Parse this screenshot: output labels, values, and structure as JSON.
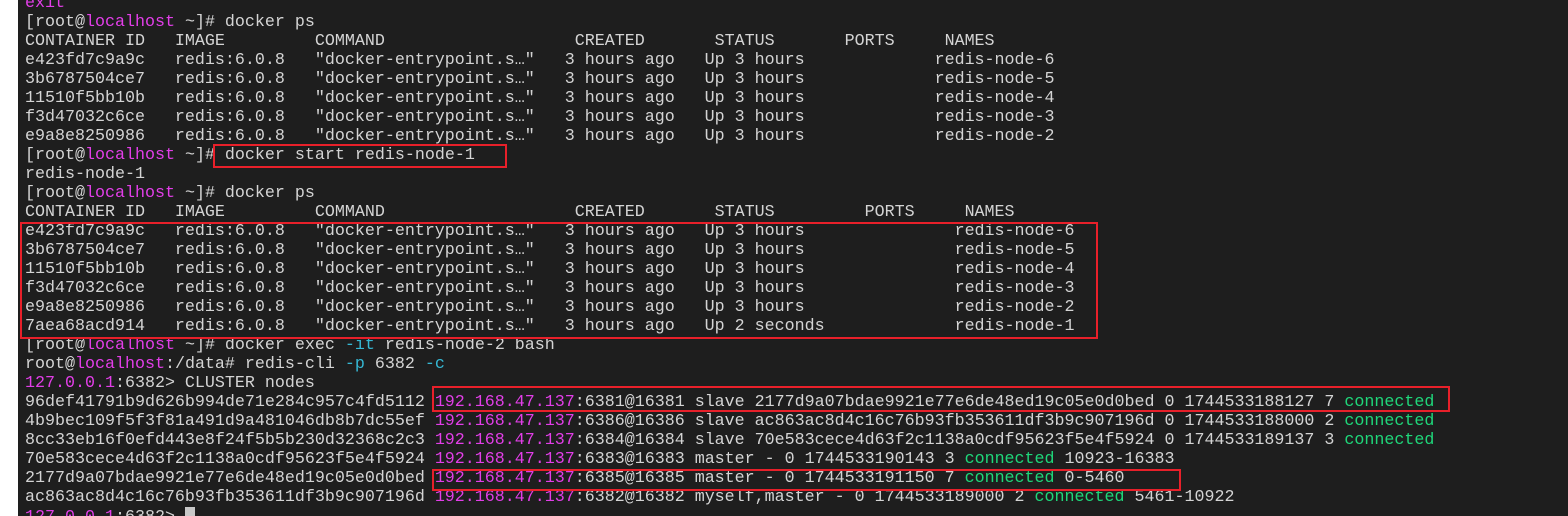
{
  "terminal": {
    "colors": {
      "background": "#1e1e1e",
      "text": "#d4d4d4",
      "host": "#e23ee8",
      "flag": "#35b8d4",
      "connected": "#1fd77a",
      "highlight_box": "#e8202a"
    },
    "lines": [
      [
        [
          "exit",
          "m"
        ]
      ],
      [
        [
          "[root@",
          ""
        ],
        [
          "localhost",
          "m"
        ],
        [
          " ~]# docker ps",
          ""
        ]
      ],
      [
        [
          "CONTAINER ID   IMAGE         COMMAND                   CREATED       STATUS       PORTS     NAMES",
          ""
        ]
      ],
      [
        [
          "e423fd7c9a9c   redis:6.0.8   \"docker-entrypoint.s…\"   3 hours ago   Up 3 hours             redis-node-6",
          ""
        ]
      ],
      [
        [
          "3b6787504ce7   redis:6.0.8   \"docker-entrypoint.s…\"   3 hours ago   Up 3 hours             redis-node-5",
          ""
        ]
      ],
      [
        [
          "11510f5bb10b   redis:6.0.8   \"docker-entrypoint.s…\"   3 hours ago   Up 3 hours             redis-node-4",
          ""
        ]
      ],
      [
        [
          "f3d47032c6ce   redis:6.0.8   \"docker-entrypoint.s…\"   3 hours ago   Up 3 hours             redis-node-3",
          ""
        ]
      ],
      [
        [
          "e9a8e8250986   redis:6.0.8   \"docker-entrypoint.s…\"   3 hours ago   Up 3 hours             redis-node-2",
          ""
        ]
      ],
      [
        [
          "[root@",
          ""
        ],
        [
          "localhost",
          "m"
        ],
        [
          " ~]# docker start redis-node-1",
          ""
        ]
      ],
      [
        [
          "redis-node-1",
          ""
        ]
      ],
      [
        [
          "[root@",
          ""
        ],
        [
          "localhost",
          "m"
        ],
        [
          " ~]# docker ps",
          ""
        ]
      ],
      [
        [
          "CONTAINER ID   IMAGE         COMMAND                   CREATED       STATUS         PORTS     NAMES",
          ""
        ]
      ],
      [
        [
          "e423fd7c9a9c   redis:6.0.8   \"docker-entrypoint.s…\"   3 hours ago   Up 3 hours               redis-node-6",
          ""
        ]
      ],
      [
        [
          "3b6787504ce7   redis:6.0.8   \"docker-entrypoint.s…\"   3 hours ago   Up 3 hours               redis-node-5",
          ""
        ]
      ],
      [
        [
          "11510f5bb10b   redis:6.0.8   \"docker-entrypoint.s…\"   3 hours ago   Up 3 hours               redis-node-4",
          ""
        ]
      ],
      [
        [
          "f3d47032c6ce   redis:6.0.8   \"docker-entrypoint.s…\"   3 hours ago   Up 3 hours               redis-node-3",
          ""
        ]
      ],
      [
        [
          "e9a8e8250986   redis:6.0.8   \"docker-entrypoint.s…\"   3 hours ago   Up 3 hours               redis-node-2",
          ""
        ]
      ],
      [
        [
          "7aea68acd914   redis:6.0.8   \"docker-entrypoint.s…\"   3 hours ago   Up 2 seconds             redis-node-1",
          ""
        ]
      ],
      [
        [
          "[root@",
          ""
        ],
        [
          "localhost",
          "m"
        ],
        [
          " ~]# docker exec ",
          ""
        ],
        [
          "-it",
          "c"
        ],
        [
          " redis-node-2 bash",
          ""
        ]
      ],
      [
        [
          "root@",
          ""
        ],
        [
          "localhost",
          "m"
        ],
        [
          ":/data# redis-cli ",
          ""
        ],
        [
          "-p",
          "c"
        ],
        [
          " 6382 ",
          ""
        ],
        [
          "-c",
          "c"
        ]
      ],
      [
        [
          "127.0.0.1",
          "m"
        ],
        [
          ":6382> CLUSTER nodes",
          ""
        ]
      ],
      [
        [
          "96def41791b9d626b994de71e284c957c4fd5112 ",
          ""
        ],
        [
          "192.168.47.137",
          "m"
        ],
        [
          ":6381@16381 slave 2177d9a07bdae9921e77e6de48ed19c05e0d0bed 0 1744533188127 7 ",
          ""
        ],
        [
          "connected",
          "g"
        ]
      ],
      [
        [
          "4b9bec109f5f3f81a491d9a481046db8b7dc55ef ",
          ""
        ],
        [
          "192.168.47.137",
          "m"
        ],
        [
          ":6386@16386 slave ac863ac8d4c16c76b93fb353611df3b9c907196d 0 1744533188000 2 ",
          ""
        ],
        [
          "connected",
          "g"
        ]
      ],
      [
        [
          "8cc33eb16f0efd443e8f24f5b5b230d32368c2c3 ",
          ""
        ],
        [
          "192.168.47.137",
          "m"
        ],
        [
          ":6384@16384 slave 70e583cece4d63f2c1138a0cdf95623f5e4f5924 0 1744533189137 3 ",
          ""
        ],
        [
          "connected",
          "g"
        ]
      ],
      [
        [
          "70e583cece4d63f2c1138a0cdf95623f5e4f5924 ",
          ""
        ],
        [
          "192.168.47.137",
          "m"
        ],
        [
          ":6383@16383 master - 0 1744533190143 3 ",
          ""
        ],
        [
          "connected",
          "g"
        ],
        [
          " 10923-16383",
          ""
        ]
      ],
      [
        [
          "2177d9a07bdae9921e77e6de48ed19c05e0d0bed ",
          ""
        ],
        [
          "192.168.47.137",
          "m"
        ],
        [
          ":6385@16385 master - 0 1744533191150 7 ",
          ""
        ],
        [
          "connected",
          "g"
        ],
        [
          " 0-5460",
          ""
        ]
      ],
      [
        [
          "ac863ac8d4c16c76b93fb353611df3b9c907196d ",
          ""
        ],
        [
          "192.168.47.137",
          "m"
        ],
        [
          ":6382@16382 myself,master - 0 1744533189000 2 ",
          ""
        ],
        [
          "connected",
          "g"
        ],
        [
          " 5461-10922",
          ""
        ]
      ],
      [
        [
          "127.0.0.1",
          "m"
        ],
        [
          ":6382> ",
          ""
        ]
      ]
    ]
  }
}
